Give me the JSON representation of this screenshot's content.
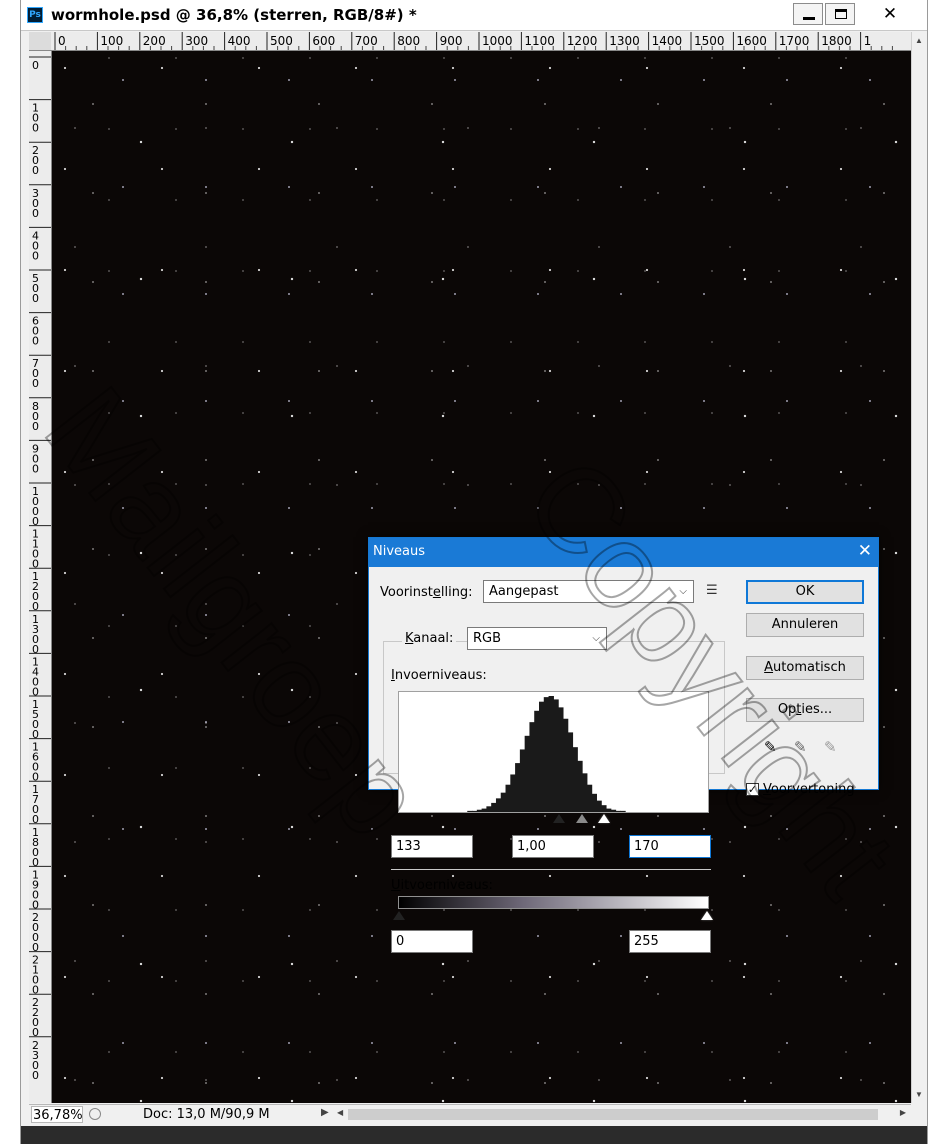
{
  "window": {
    "app_icon": "Ps",
    "title": "wormhole.psd @ 36,8% (sterren, RGB/8#) *",
    "close_glyph": "✕"
  },
  "rulers": {
    "horizontal_ticks": [
      "0",
      "100",
      "200",
      "300",
      "400",
      "500",
      "600",
      "700",
      "800",
      "900",
      "1000",
      "1100",
      "1200",
      "1300",
      "1400",
      "1500",
      "1600",
      "1700",
      "1800",
      "1"
    ],
    "vertical_labels": [
      "0",
      "100",
      "200",
      "300",
      "400",
      "500",
      "600",
      "700",
      "800",
      "900",
      "1000",
      "1100",
      "1200",
      "1300",
      "1400",
      "1500",
      "1600",
      "1700",
      "1800",
      "1900",
      "2000",
      "2100",
      "2200",
      "2300"
    ]
  },
  "statusbar": {
    "zoom": "36,78%",
    "doc_info": "Doc: 13,0 M/90,9 M"
  },
  "dialog": {
    "title": "Niveaus",
    "preset_label_pre": "Voorinst",
    "preset_label_u": "e",
    "preset_label_post": "lling:",
    "preset_value": "Aangepast",
    "channel_label_u": "K",
    "channel_label_post": "anaal:",
    "channel_value": "RGB",
    "input_levels_label_u": "I",
    "input_levels_label_post": "nvoerniveaus:",
    "input_black": "133",
    "input_gamma": "1,00",
    "input_white": "170",
    "output_levels_label_u": "U",
    "output_levels_label_post": "itvoerniveaus:",
    "output_black": "0",
    "output_white": "255",
    "buttons": {
      "ok": "OK",
      "cancel": "Annuleren",
      "auto_u": "A",
      "auto_post": "utomatisch",
      "options_pre": "Op",
      "options_u": "t",
      "options_post": "ies..."
    },
    "preview_label_u": "V",
    "preview_label_post": "oorvertoning",
    "preview_checked": true,
    "histogram": {
      "description_values": [
        0,
        0,
        0,
        0,
        0,
        0,
        0,
        0,
        1,
        1,
        2,
        3,
        5,
        8,
        12,
        17,
        24,
        33,
        43,
        55,
        67,
        79,
        89,
        97,
        101,
        102,
        99,
        92,
        82,
        70,
        57,
        45,
        34,
        24,
        16,
        10,
        6,
        3,
        2,
        1,
        1,
        0,
        0,
        0,
        0,
        0
      ]
    }
  },
  "watermark": {
    "line1": "Mailgroep",
    "line2": "Copyright"
  },
  "colors": {
    "dialog_titlebar": "#1a7ad6",
    "canvas": "#0b0706"
  }
}
